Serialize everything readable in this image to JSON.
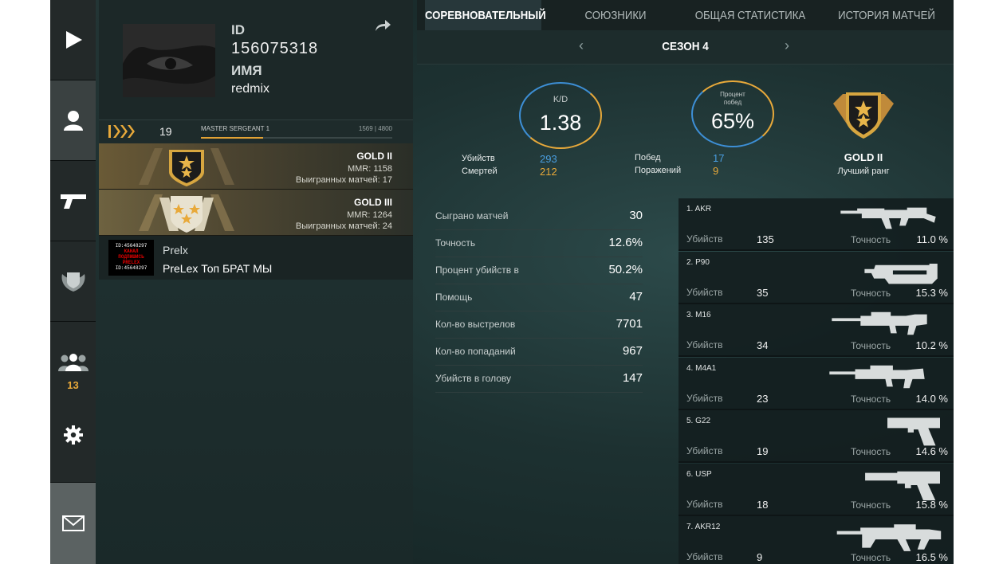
{
  "rail": {
    "items": [
      {
        "id": "play",
        "icon": "play-icon"
      },
      {
        "id": "profile",
        "icon": "user-icon"
      },
      {
        "id": "weapons",
        "icon": "pistol-icon"
      },
      {
        "id": "rank",
        "icon": "shield-icon"
      },
      {
        "id": "friends",
        "icon": "friends-icon",
        "count": "13"
      },
      {
        "id": "settings",
        "icon": "gear-icon"
      },
      {
        "id": "mail",
        "icon": "mail-icon"
      }
    ],
    "friends_count": "13"
  },
  "profile": {
    "id_label": "ID",
    "id_value": "156075318",
    "name_label": "ИМЯ",
    "name_value": "redmix",
    "level": "19",
    "rank_title": "MASTER SERGEANT 1",
    "xp_text": "1569 | 4800",
    "xp_progress": 0.327
  },
  "ranks": [
    {
      "name": "GOLD II",
      "mmr": "MMR: 1158",
      "wins": "Выигранных матчей: 17"
    },
    {
      "name": "GOLD III",
      "mmr": "MMR: 1264",
      "wins": "Выигранных матчей: 24"
    }
  ],
  "clan": {
    "logo_lines": [
      "ID:45648297",
      "КАНАЛ",
      "ПОДПИШИСЬ",
      "PRELEX",
      "ID:45648297"
    ],
    "tag": "Prelx",
    "name": "PreLex Топ БРАТ МЫ"
  },
  "tabs": [
    "СОРЕВНОВАТЕЛЬНЫЙ",
    "СОЮЗНИКИ",
    "ОБЩАЯ СТАТИСТИКА",
    "ИСТОРИЯ МАТЧЕЙ"
  ],
  "active_tab": "СОРЕВНОВАТЕЛЬНЫЙ",
  "season": {
    "label": "СЕЗОН 4",
    "prev": "‹",
    "next": "›"
  },
  "summary": {
    "kd_label": "K/D",
    "kd_value": "1.38",
    "kills_label": "Убийств",
    "kills_value": "293",
    "deaths_label": "Смертей",
    "deaths_value": "212",
    "winrate_label": "Процент побед",
    "winrate_value": "65%",
    "wins_label": "Побед",
    "wins_value": "17",
    "losses_label": "Поражений",
    "losses_value": "9",
    "best_rank": "GOLD II",
    "best_rank_caption": "Лучший ранг"
  },
  "stats": [
    {
      "label": "Сыграно матчей",
      "value": "30"
    },
    {
      "label": "Точность",
      "value": "12.6%"
    },
    {
      "label": "Процент убийств в",
      "value": "50.2%"
    },
    {
      "label": "Помощь",
      "value": "47"
    },
    {
      "label": "Кол-во выстрелов",
      "value": "7701"
    },
    {
      "label": "Кол-во попаданий",
      "value": "967"
    },
    {
      "label": "Убийств в голову",
      "value": "147"
    }
  ],
  "weapons_kills_label": "Убийств",
  "weapons_acc_label": "Точность",
  "weapons": [
    {
      "name": "1. AKR",
      "kills": "135",
      "accuracy": "11.0 %",
      "icon": "rifle-akr-icon"
    },
    {
      "name": "2. P90",
      "kills": "35",
      "accuracy": "15.3 %",
      "icon": "smg-p90-icon"
    },
    {
      "name": "3. M16",
      "kills": "34",
      "accuracy": "10.2 %",
      "icon": "rifle-m16-icon"
    },
    {
      "name": "4. M4A1",
      "kills": "23",
      "accuracy": "14.0 %",
      "icon": "rifle-m4a1-icon"
    },
    {
      "name": "5. G22",
      "kills": "19",
      "accuracy": "14.6 %",
      "icon": "pistol-g22-icon"
    },
    {
      "name": "6. USP",
      "kills": "18",
      "accuracy": "15.8 %",
      "icon": "pistol-usp-icon"
    },
    {
      "name": "7. AKR12",
      "kills": "9",
      "accuracy": "16.5 %",
      "icon": "rifle-akr12-icon"
    }
  ],
  "colors": {
    "accent": "#e8a93a",
    "blue": "#4a9ee0",
    "rail": "#1b2020"
  }
}
